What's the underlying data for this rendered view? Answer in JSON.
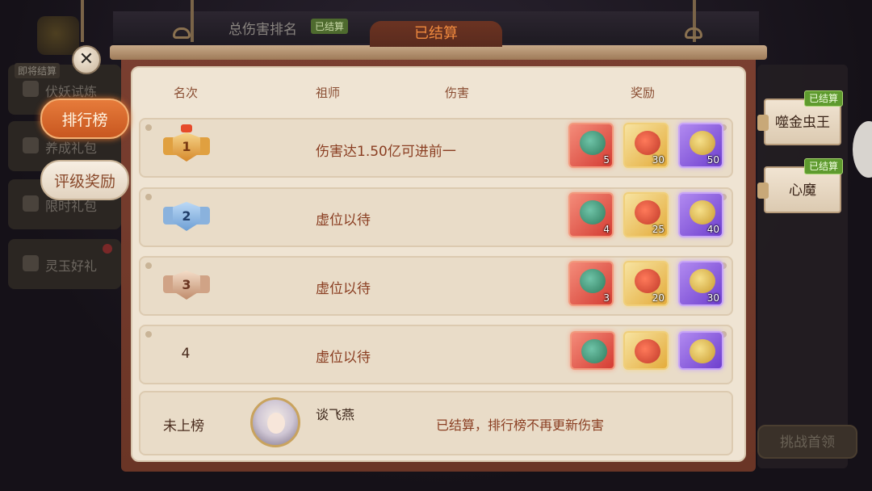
{
  "background": {
    "top_title": "总伤害排名",
    "top_badge": "已结算",
    "side_items": [
      {
        "tag": "即将结算",
        "label": "伏妖试炼"
      },
      {
        "tag": "",
        "label": "养成礼包"
      },
      {
        "tag": "",
        "label": "限时礼包"
      },
      {
        "tag": "",
        "label": "灵玉好礼"
      }
    ],
    "challenge_button": "挑战首领"
  },
  "left_nav": {
    "close_label": "✕",
    "buttons": [
      {
        "label": "排行榜",
        "active": true
      },
      {
        "label": "评级奖励",
        "active": false
      }
    ]
  },
  "panel": {
    "tab_title": "已结算",
    "headers": {
      "rank": "名次",
      "master": "祖师",
      "damage": "伤害",
      "reward": "奖励"
    },
    "rows": [
      {
        "rank": "1",
        "text": "伤害达1.50亿可进前一",
        "rewards": [
          {
            "type": "red",
            "count": "5"
          },
          {
            "type": "gold",
            "count": "30"
          },
          {
            "type": "purple",
            "count": "50"
          }
        ]
      },
      {
        "rank": "2",
        "text": "虚位以待",
        "rewards": [
          {
            "type": "red",
            "count": "4"
          },
          {
            "type": "gold",
            "count": "25"
          },
          {
            "type": "purple",
            "count": "40"
          }
        ]
      },
      {
        "rank": "3",
        "text": "虚位以待",
        "rewards": [
          {
            "type": "red",
            "count": "3"
          },
          {
            "type": "gold",
            "count": "20"
          },
          {
            "type": "purple",
            "count": "30"
          }
        ]
      },
      {
        "rank": "4",
        "text": "虚位以待",
        "rewards": [
          {
            "type": "red",
            "count": ""
          },
          {
            "type": "gold",
            "count": ""
          },
          {
            "type": "purple",
            "count": ""
          }
        ]
      }
    ],
    "me": {
      "rank": "未上榜",
      "name": "谈飞燕",
      "note": "已结算，排行榜不再更新伤害"
    }
  },
  "bosses": [
    {
      "name": "噬金虫王",
      "status": "已结算"
    },
    {
      "name": "心魔",
      "status": "已结算"
    }
  ],
  "colors": {
    "accent": "#e67b3b",
    "done_green": "#5e9a2e",
    "text_brown": "#8a3e22"
  }
}
